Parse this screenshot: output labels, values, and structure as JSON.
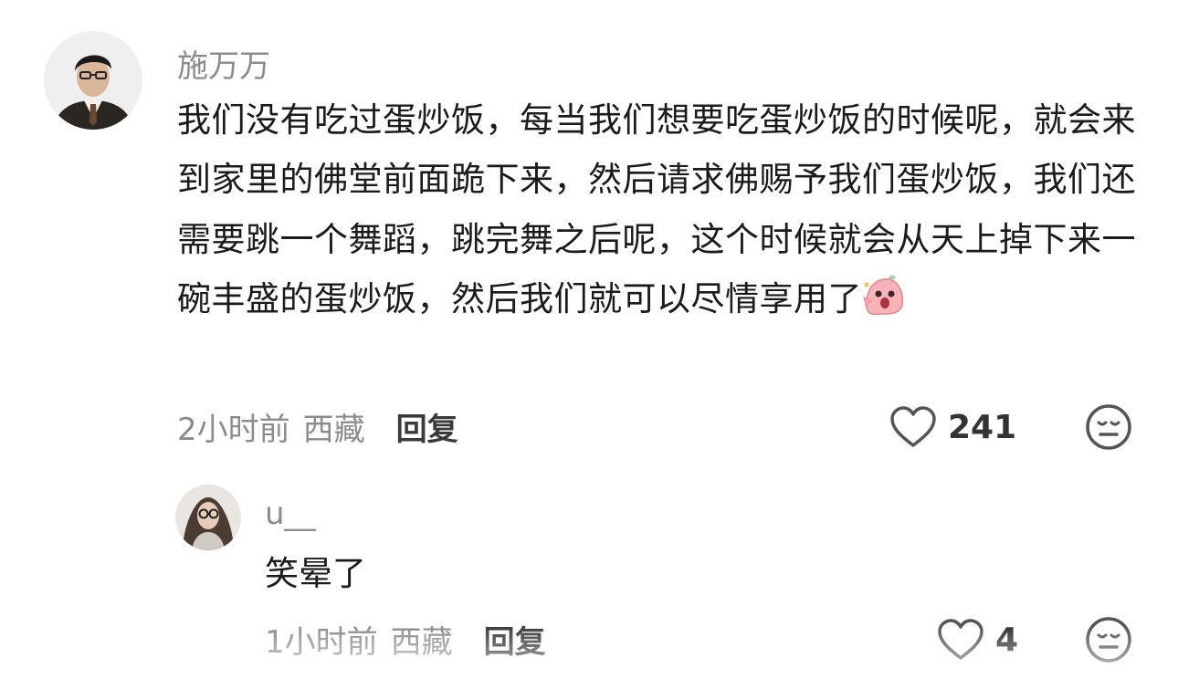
{
  "comments": [
    {
      "user": {
        "name": "施万万",
        "avatar_icon": "avatar-man-in-suit"
      },
      "text": "我们没有吃过蛋炒饭，每当我们想要吃蛋炒饭的时候呢，就会来到家里的佛堂前面跪下来，然后请求佛赐予我们蛋炒饭，我们还需要跳一个舞蹈，跳完舞之后呢，这个时候就会从天上掉下来一碗丰盛的蛋炒饭，然后我们就可以尽情享用了",
      "emoji_icon": "excited-pink-blob-emoji",
      "time": "2小时前",
      "location": "西藏",
      "reply_label": "回复",
      "like_count": "241",
      "like_icon": "heart-icon",
      "dislike_icon": "meh-face-icon"
    },
    {
      "user": {
        "name": "u__",
        "avatar_icon": "avatar-woman-with-glasses"
      },
      "text": "笑晕了",
      "time": "1小时前",
      "location": "西藏",
      "reply_label": "回复",
      "like_count": "4",
      "like_icon": "heart-icon",
      "dislike_icon": "meh-face-icon"
    }
  ],
  "colors": {
    "secondary_text": "#8c8c8c",
    "primary_text": "#1b1b1b",
    "icon": "#555555"
  }
}
